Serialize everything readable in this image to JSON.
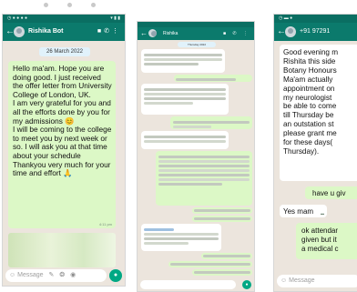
{
  "phone1": {
    "contact_name": "Rishika Bot",
    "date_chip": "26 March 2022",
    "message_text": "Hello ma'am. Hope you are doing good. I just received the offer letter from University College of London, UK.\nI am very grateful for you and all the efforts done by you for my admissions 😊\nI will be coming to the college to meet you by next week or so. I will ask you at that time about your schedule\nThankyou very much for your time and effort 🙏",
    "message_time": "4:11 pm",
    "input_placeholder": "Message",
    "icon_back": "←",
    "icon_video": "video-icon",
    "icon_call": "call-icon"
  },
  "phone2": {
    "contact_name": "Rishika",
    "date_chip": "Thursday 2022"
  },
  "phone3": {
    "contact_name": "+91 97291",
    "message_main": "Good evening m\nRishita this side\nBotany Honours\nMa'am actually\nappointment on\nmy neurologist\nbe able to come\ntill Thursday be\nan outstation st\nplease grant me\nfor these days(\nThursday).",
    "reply_1": "have u giv",
    "message_2": "Yes mam",
    "reply_2": "ok attendar\ngiven but it\na medical c",
    "input_placeholder": "Message"
  },
  "colors": {
    "header": "#0b7a6c",
    "background": "#ece5dd",
    "outgoing": "#dcf8c6",
    "incoming": "#ffffff",
    "accent": "#00a884"
  }
}
